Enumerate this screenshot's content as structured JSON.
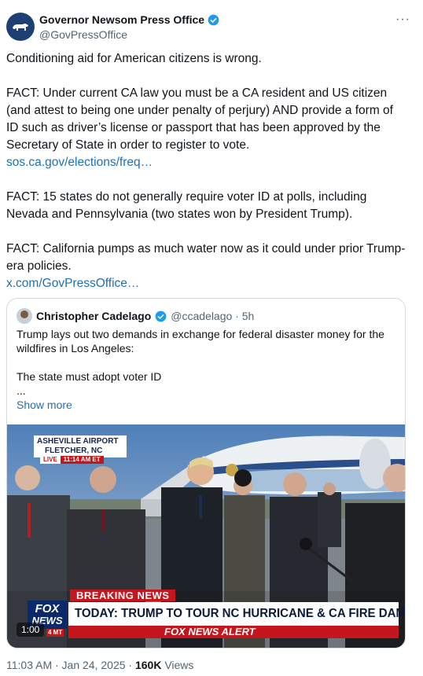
{
  "post": {
    "author_name": "Governor Newsom Press Office",
    "author_handle": "@GovPressOffice",
    "more_label": "···",
    "paragraph1": "Conditioning aid for American citizens is wrong.",
    "paragraph2": "FACT: Under current CA law you must be a CA resident and US citizen (and attest to being one under penalty of perjury) AND provide a form of ID such as driver’s license or passport that has been approved by the Secretary of State in order to register to vote.",
    "link1": "sos.ca.gov/elections/freq…",
    "paragraph3": "FACT: 15 states do not generally require voter ID at polls, including Nevada and Pennsylvania (two states won by President Trump).",
    "paragraph4": "FACT: California pumps as much water now as it could under prior Trump-era policies.",
    "link2": "x.com/GovPressOffice…"
  },
  "quote": {
    "author_name": "Christopher Cadelago",
    "author_handle_time": "@ccadelago · 5h",
    "line1": "Trump lays out two demands in exchange for federal disaster money for the wildfires in Los Angeles:",
    "line2": "The state must adopt voter ID",
    "line3": "...",
    "show_more": "Show more",
    "video": {
      "location_line1": "ASHEVILLE AIRPORT",
      "location_line2": "FLETCHER, NC",
      "live_label": "LIVE",
      "live_time": "11:14 AM ET",
      "breaking_label": "BREAKING NEWS",
      "headline": "TODAY: TRUMP TO TOUR NC HURRICANE & CA FIRE DAMAGE",
      "alert_label": "FOX NEWS ALERT",
      "logo_line1": "FOX",
      "logo_line2": "NEWS",
      "clock": "4 MT",
      "duration": "1:00"
    }
  },
  "footer": {
    "timestamp": "11:03 AM · Jan 24, 2025 ·",
    "views_count": "160K",
    "views_label": "Views"
  }
}
